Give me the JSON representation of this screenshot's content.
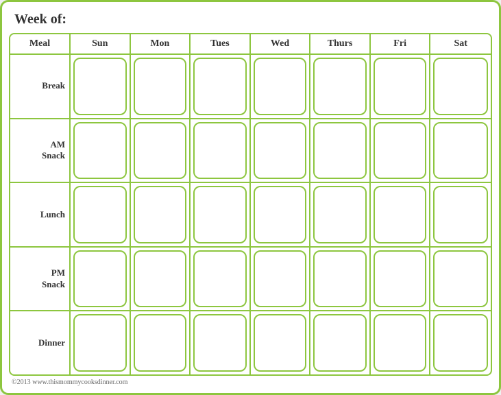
{
  "header": {
    "week_of_label": "Week of:",
    "columns": [
      "Meal",
      "Sun",
      "Mon",
      "Tues",
      "Wed",
      "Thurs",
      "Fri",
      "Sat"
    ]
  },
  "rows": [
    {
      "label": "Break"
    },
    {
      "label": "AM\nSnack"
    },
    {
      "label": "Lunch"
    },
    {
      "label": "PM\nSnack"
    },
    {
      "label": "Dinner"
    }
  ],
  "footer": {
    "copyright": "©2013 www.thismommycooksdinner.com"
  }
}
